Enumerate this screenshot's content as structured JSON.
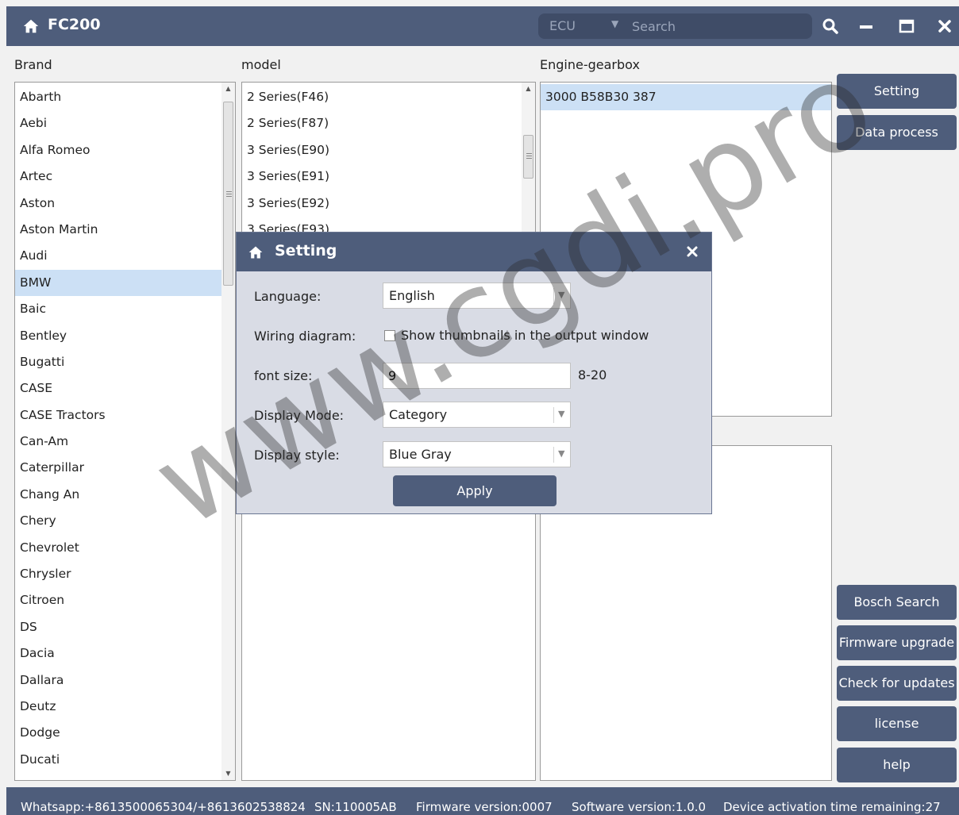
{
  "window": {
    "title": "FC200"
  },
  "search": {
    "ecu_label": "ECU",
    "placeholder": "Search"
  },
  "columns": {
    "brand": "Brand",
    "model": "model",
    "engine": "Engine-gearbox"
  },
  "brands": [
    "Abarth",
    "Aebi",
    "Alfa Romeo",
    "Artec",
    "Aston",
    "Aston Martin",
    "Audi",
    "BMW",
    "Baic",
    "Bentley",
    "Bugatti",
    "CASE",
    "CASE Tractors",
    "Can-Am",
    "Caterpillar",
    "Chang An",
    "Chery",
    "Chevrolet",
    "Chrysler",
    "Citroen",
    "DS",
    "Dacia",
    "Dallara",
    "Deutz",
    "Dodge",
    "Ducati"
  ],
  "selected_brand": "BMW",
  "models": [
    "2 Series(F46)",
    "2 Series(F87)",
    "3 Series(E90)",
    "3 Series(E91)",
    "3 Series(E92)",
    "3 Series(E93)"
  ],
  "engines": [
    "3000 B58B30 387"
  ],
  "side_buttons": {
    "setting": "Setting",
    "data_process": "Data process",
    "bosch_search": "Bosch Search",
    "firmware_upgrade": "Firmware upgrade",
    "check_updates": "Check for updates",
    "license": "license",
    "help": "help"
  },
  "status": {
    "whatsapp": "Whatsapp:+8613500065304/+8613602538824",
    "sn": "SN:110005AB",
    "firmware": "Firmware version:0007",
    "software": "Software version:1.0.0",
    "activation": "Device activation time remaining:27"
  },
  "dialog": {
    "title": "Setting",
    "language_label": "Language:",
    "language_value": "English",
    "wiring_label": "Wiring diagram:",
    "wiring_checkbox_label": "Show thumbnails in the output window",
    "wiring_checked": false,
    "font_label": "font size:",
    "font_value": "9",
    "font_range": "8-20",
    "display_mode_label": "Display Mode:",
    "display_mode_value": "Category",
    "display_style_label": "Display style:",
    "display_style_value": "Blue Gray",
    "apply": "Apply"
  },
  "watermark": "www.cgdi.pro",
  "colors": {
    "theme": "#4e5d7b",
    "selection": "#cce0f5"
  }
}
